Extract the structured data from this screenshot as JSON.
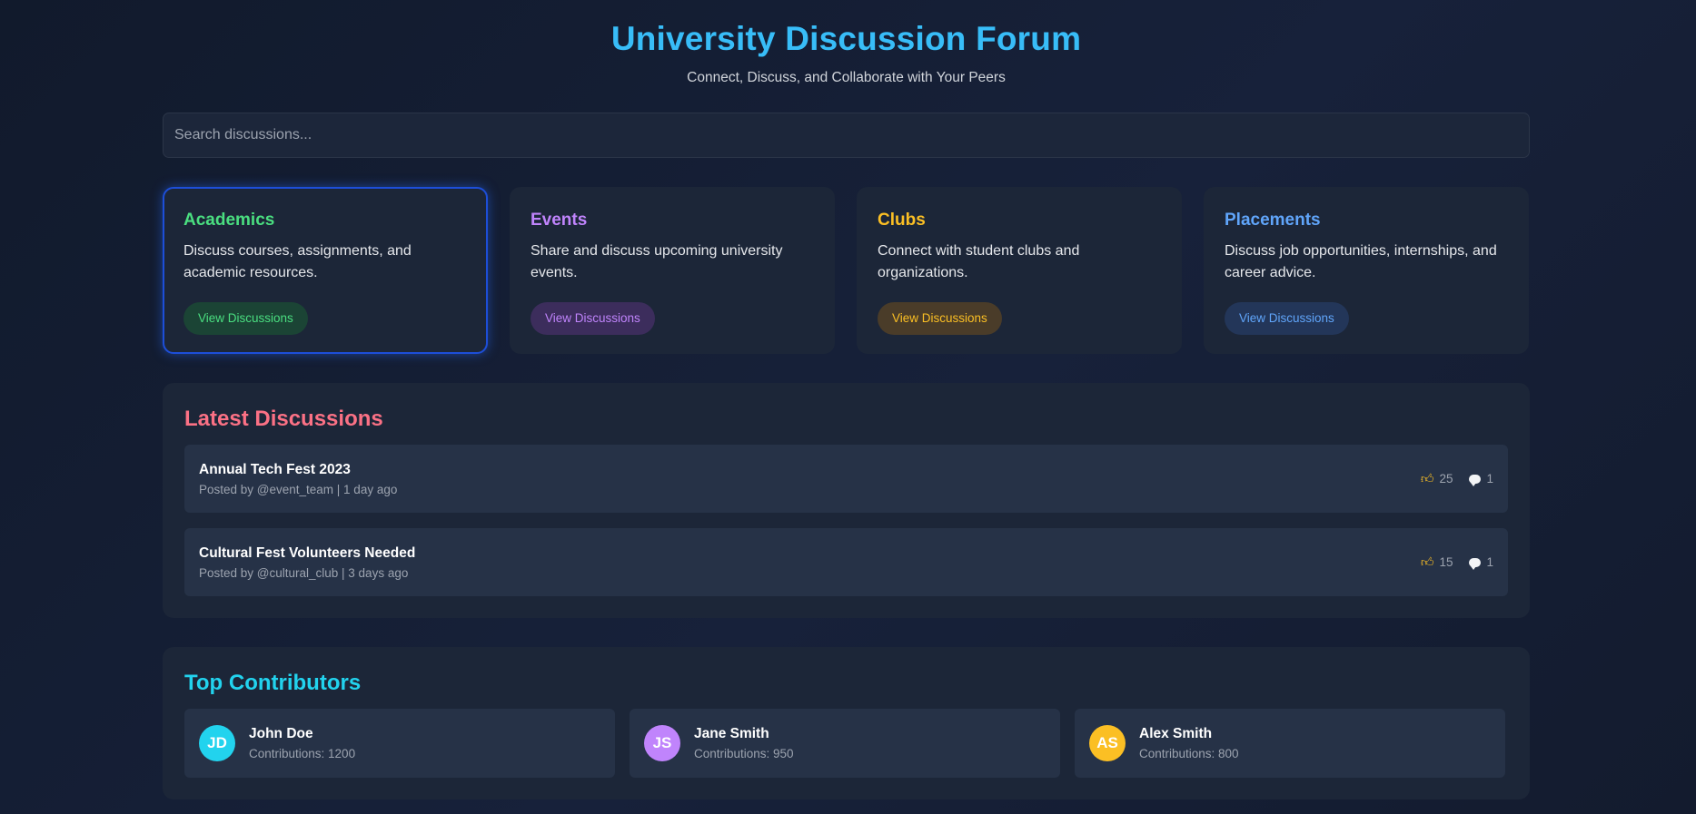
{
  "header": {
    "title": "University Discussion Forum",
    "subtitle": "Connect, Discuss, and Collaborate with Your Peers"
  },
  "search": {
    "placeholder": "Search discussions..."
  },
  "categories": [
    {
      "title": "Academics",
      "description": "Discuss courses, assignments, and academic resources.",
      "button": "View Discussions",
      "color": "#4ade80",
      "button_bg": "#1b4435",
      "active": true
    },
    {
      "title": "Events",
      "description": "Share and discuss upcoming university events.",
      "button": "View Discussions",
      "color": "#c084fc",
      "button_bg": "#3c2d5c",
      "active": false
    },
    {
      "title": "Clubs",
      "description": "Connect with student clubs and organizations.",
      "button": "View Discussions",
      "color": "#fbbf24",
      "button_bg": "#4a3c29",
      "active": false
    },
    {
      "title": "Placements",
      "description": "Discuss job opportunities, internships, and career advice.",
      "button": "View Discussions",
      "color": "#60a5fa",
      "button_bg": "#233659",
      "active": false
    }
  ],
  "latest": {
    "title": "Latest Discussions",
    "title_color": "#fb7185",
    "items": [
      {
        "title": "Annual Tech Fest 2023",
        "meta": "Posted by @event_team | 1 day ago",
        "likes": "25",
        "comments": "1",
        "like_icon": "thumbs-up-icon",
        "comment_icon": "comment-icon"
      },
      {
        "title": "Cultural Fest Volunteers Needed",
        "meta": "Posted by @cultural_club | 3 days ago",
        "likes": "15",
        "comments": "1",
        "like_icon": "thumbs-up-icon",
        "comment_icon": "comment-icon"
      }
    ]
  },
  "contributors": {
    "title": "Top Contributors",
    "title_color": "#22d3ee",
    "items": [
      {
        "initials": "JD",
        "name": "John Doe",
        "count": "Contributions: 1200",
        "avatar_color": "#22d3ee"
      },
      {
        "initials": "JS",
        "name": "Jane Smith",
        "count": "Contributions: 950",
        "avatar_color": "#c084fc"
      },
      {
        "initials": "AS",
        "name": "Alex Smith",
        "count": "Contributions: 800",
        "avatar_color": "#fbbf24"
      }
    ]
  }
}
